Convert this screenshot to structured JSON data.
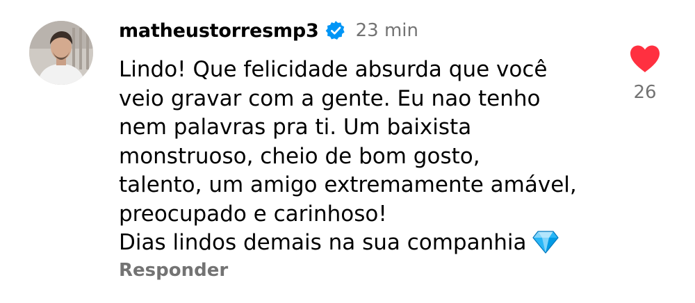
{
  "comment": {
    "username": "matheustorresmp3",
    "verified": true,
    "timestamp": "23 min",
    "text_lines": [
      "Lindo! Que felicidade absurda que você",
      "veio gravar com a gente. Eu nao tenho",
      "nem palavras pra ti. Um baixista",
      "monstruoso, cheio de bom gosto,",
      "talento, um amigo extremamente amável,",
      "preocupado e carinhoso!",
      "Dias lindos demais na sua companhia"
    ],
    "trailing_emoji": "gem-icon",
    "reply_label": "Responder",
    "like_count": "26",
    "liked": true
  },
  "colors": {
    "verified_badge": "#0095F6",
    "heart": "#FF3040",
    "secondary_text": "#737373",
    "gem": "#4FC3F7"
  }
}
